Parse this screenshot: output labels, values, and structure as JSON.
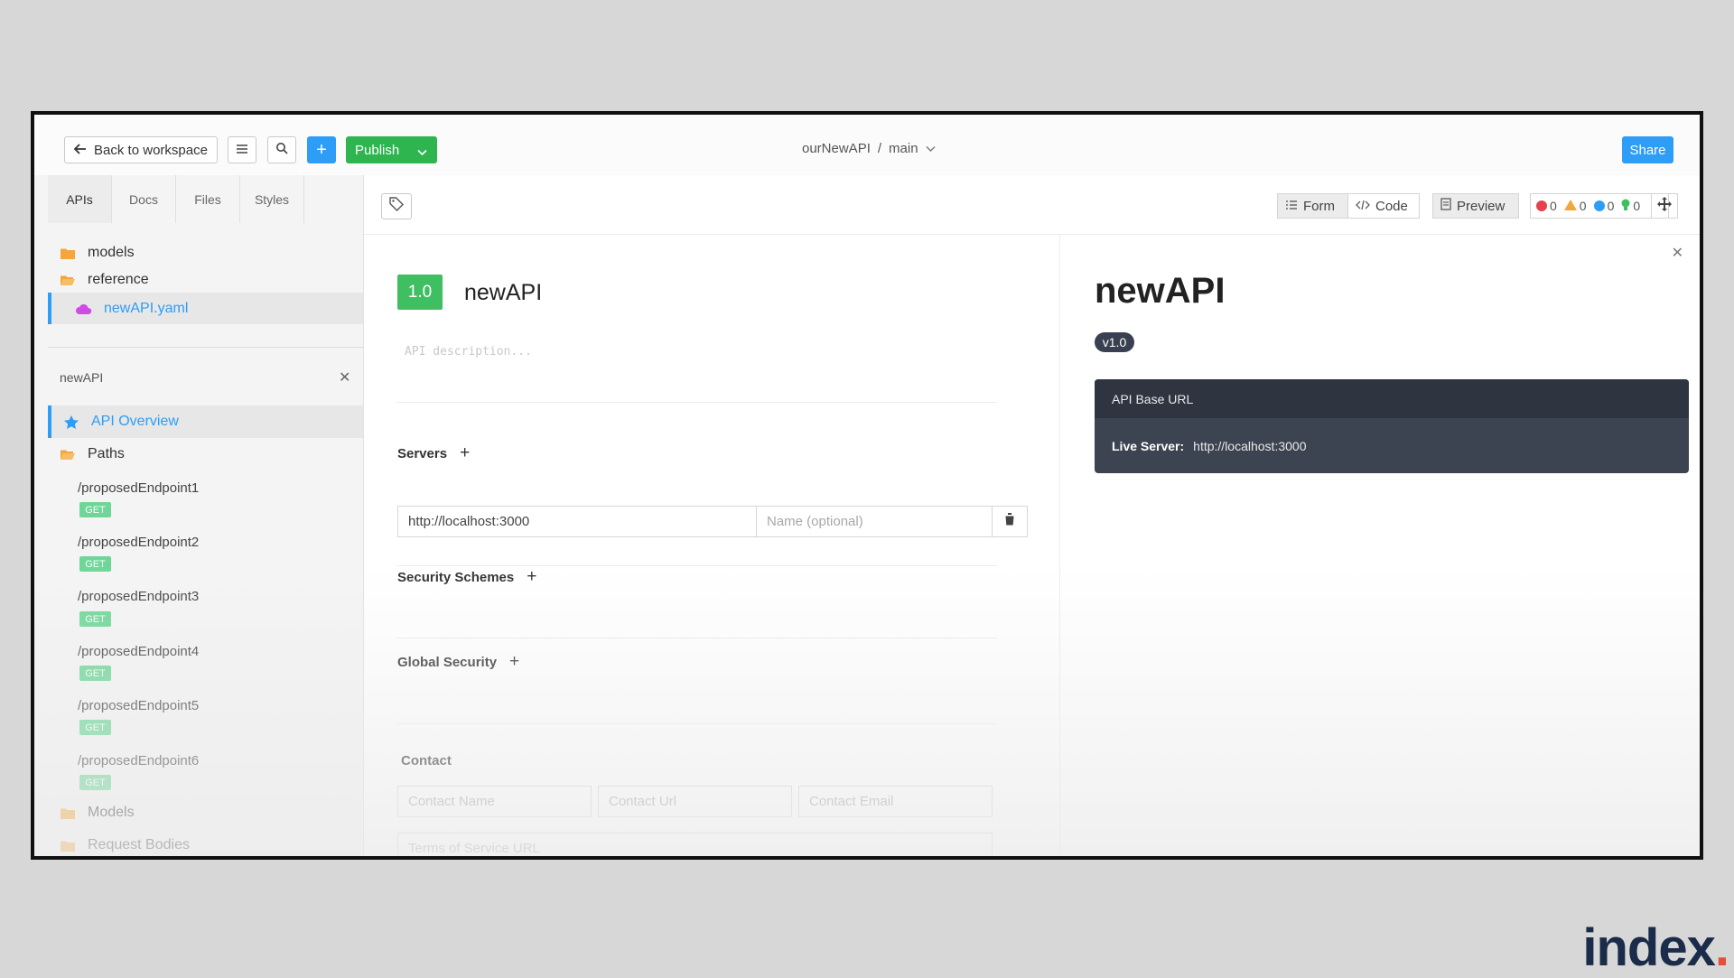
{
  "topbar": {
    "back_label": "Back to workspace",
    "publish_label": "Publish",
    "project": "ourNewAPI",
    "separator": "/",
    "branch": "main",
    "share_label": "Share"
  },
  "sidebar": {
    "tabs": [
      "APIs",
      "Docs",
      "Files",
      "Styles"
    ],
    "tree": [
      {
        "label": "models",
        "icon": "folder-icon"
      },
      {
        "label": "reference",
        "icon": "folder-open-icon"
      },
      {
        "label": "newAPI.yaml",
        "icon": "cloud-icon"
      }
    ],
    "section_title": "newAPI",
    "overview_label": "API Overview",
    "paths_label": "Paths",
    "endpoints": [
      {
        "path": "/proposedEndpoint1",
        "method": "GET"
      },
      {
        "path": "/proposedEndpoint2",
        "method": "GET"
      },
      {
        "path": "/proposedEndpoint3",
        "method": "GET"
      },
      {
        "path": "/proposedEndpoint4",
        "method": "GET"
      },
      {
        "path": "/proposedEndpoint5",
        "method": "GET"
      },
      {
        "path": "/proposedEndpoint6",
        "method": "GET"
      }
    ],
    "models_label": "Models",
    "request_bodies_label": "Request Bodies"
  },
  "toolbar": {
    "form_label": "Form",
    "code_label": "Code",
    "preview_label": "Preview",
    "errors": "0",
    "warnings": "0",
    "infos": "0",
    "hints": "0"
  },
  "editor": {
    "version": "1.0",
    "title": "newAPI",
    "description_placeholder": "API description...",
    "servers_label": "Servers",
    "server_url": "http://localhost:3000",
    "server_name_placeholder": "Name (optional)",
    "security_schemes_label": "Security Schemes",
    "global_security_label": "Global Security",
    "contact_label": "Contact",
    "contact_name_placeholder": "Contact Name",
    "contact_url_placeholder": "Contact Url",
    "contact_email_placeholder": "Contact Email",
    "tos_placeholder": "Terms of Service URL"
  },
  "preview": {
    "title": "newAPI",
    "version": "v1.0",
    "base_url_header": "API Base URL",
    "live_server_label": "Live Server:",
    "live_server_url": "http://localhost:3000"
  },
  "watermark": {
    "text": "index",
    "dot": "."
  },
  "colors": {
    "accent_blue": "#2d9df6",
    "publish_green": "#2eb550",
    "get_green": "#57d387",
    "preview_box": "#3c4451"
  }
}
